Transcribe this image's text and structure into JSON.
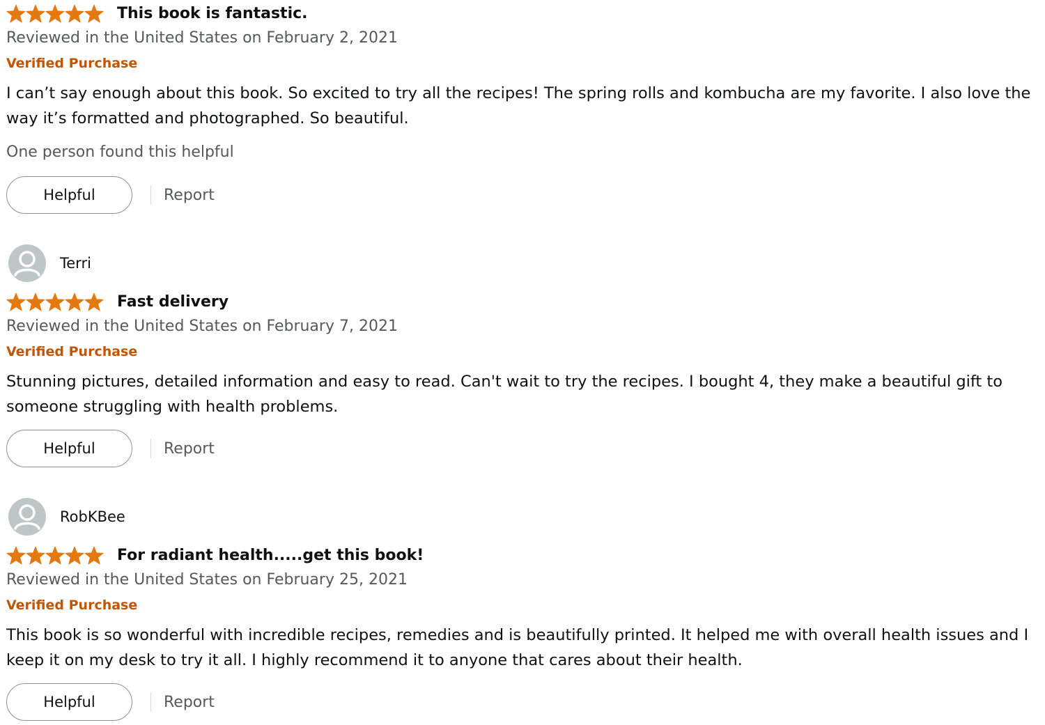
{
  "colors": {
    "star": "#e47911",
    "verified": "#c45500",
    "muted_text": "#565959",
    "body_text": "#0f1111",
    "avatar_bg": "#bfc6c6"
  },
  "reviews": [
    {
      "rating": 5,
      "title": "This book is fantastic.",
      "date": "Reviewed in the United States on February 2, 2021",
      "verified": "Verified Purchase",
      "body": "I can’t say enough about this book. So excited to try all the recipes! The spring rolls and kombucha are my favorite. I also love the way it’s formatted and photographed. So beautiful.",
      "helpful_count": "One person found this helpful",
      "helpful_label": "Helpful",
      "report_label": "Report"
    },
    {
      "reviewer": "Terri",
      "rating": 5,
      "title": "Fast delivery",
      "date": "Reviewed in the United States on February 7, 2021",
      "verified": "Verified Purchase",
      "body": "Stunning pictures, detailed information and easy to read. Can't wait to try the recipes. I bought 4, they make a beautiful gift to someone struggling with health problems.",
      "helpful_label": "Helpful",
      "report_label": "Report"
    },
    {
      "reviewer": "RobKBee",
      "rating": 5,
      "title": "For radiant health.....get this book!",
      "date": "Reviewed in the United States on February 25, 2021",
      "verified": "Verified Purchase",
      "body": "This book is so wonderful with incredible recipes, remedies and is beautifully printed. It helped me with overall health issues and I keep it on my desk to try it all. I highly recommend it to anyone that cares about their health.",
      "helpful_label": "Helpful",
      "report_label": "Report"
    }
  ]
}
